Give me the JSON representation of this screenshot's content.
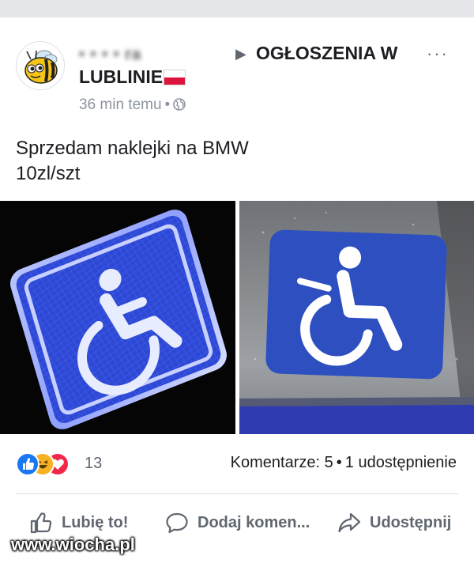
{
  "post": {
    "author_blurred": "• • • • ra",
    "group_name_line1": "OGŁOSZENIA W",
    "group_name_line2": "LUBLINIE",
    "timestamp": "36 min temu",
    "text_line1": "Sprzedam naklejki na BMW",
    "text_line2": "10zl/szt"
  },
  "icons": {
    "avatar": "bee-avatar-icon",
    "arrow": "triangle-right-icon",
    "more": "more-options-icon",
    "flag": "poland-flag-icon",
    "privacy": "globe-icon",
    "reactions": [
      "like-reaction-icon",
      "haha-reaction-icon",
      "love-reaction-icon"
    ],
    "actions": [
      "thumbs-up-icon",
      "comment-icon",
      "share-icon"
    ]
  },
  "engagement": {
    "reaction_count": "13",
    "comments": "Komentarze: 5",
    "shares": "1 udostępnienie"
  },
  "actions": {
    "like_label": "Lubię to!",
    "comment_label": "Dodaj komen...",
    "share_label": "Udostępnij"
  },
  "watermark": "www.wiocha.pl",
  "colors": {
    "like_blue": "#1877f2",
    "haha_yellow": "#f7b125",
    "love_red": "#f0284a",
    "sign_blue": "#2d48d2",
    "text_gray": "#606770"
  }
}
